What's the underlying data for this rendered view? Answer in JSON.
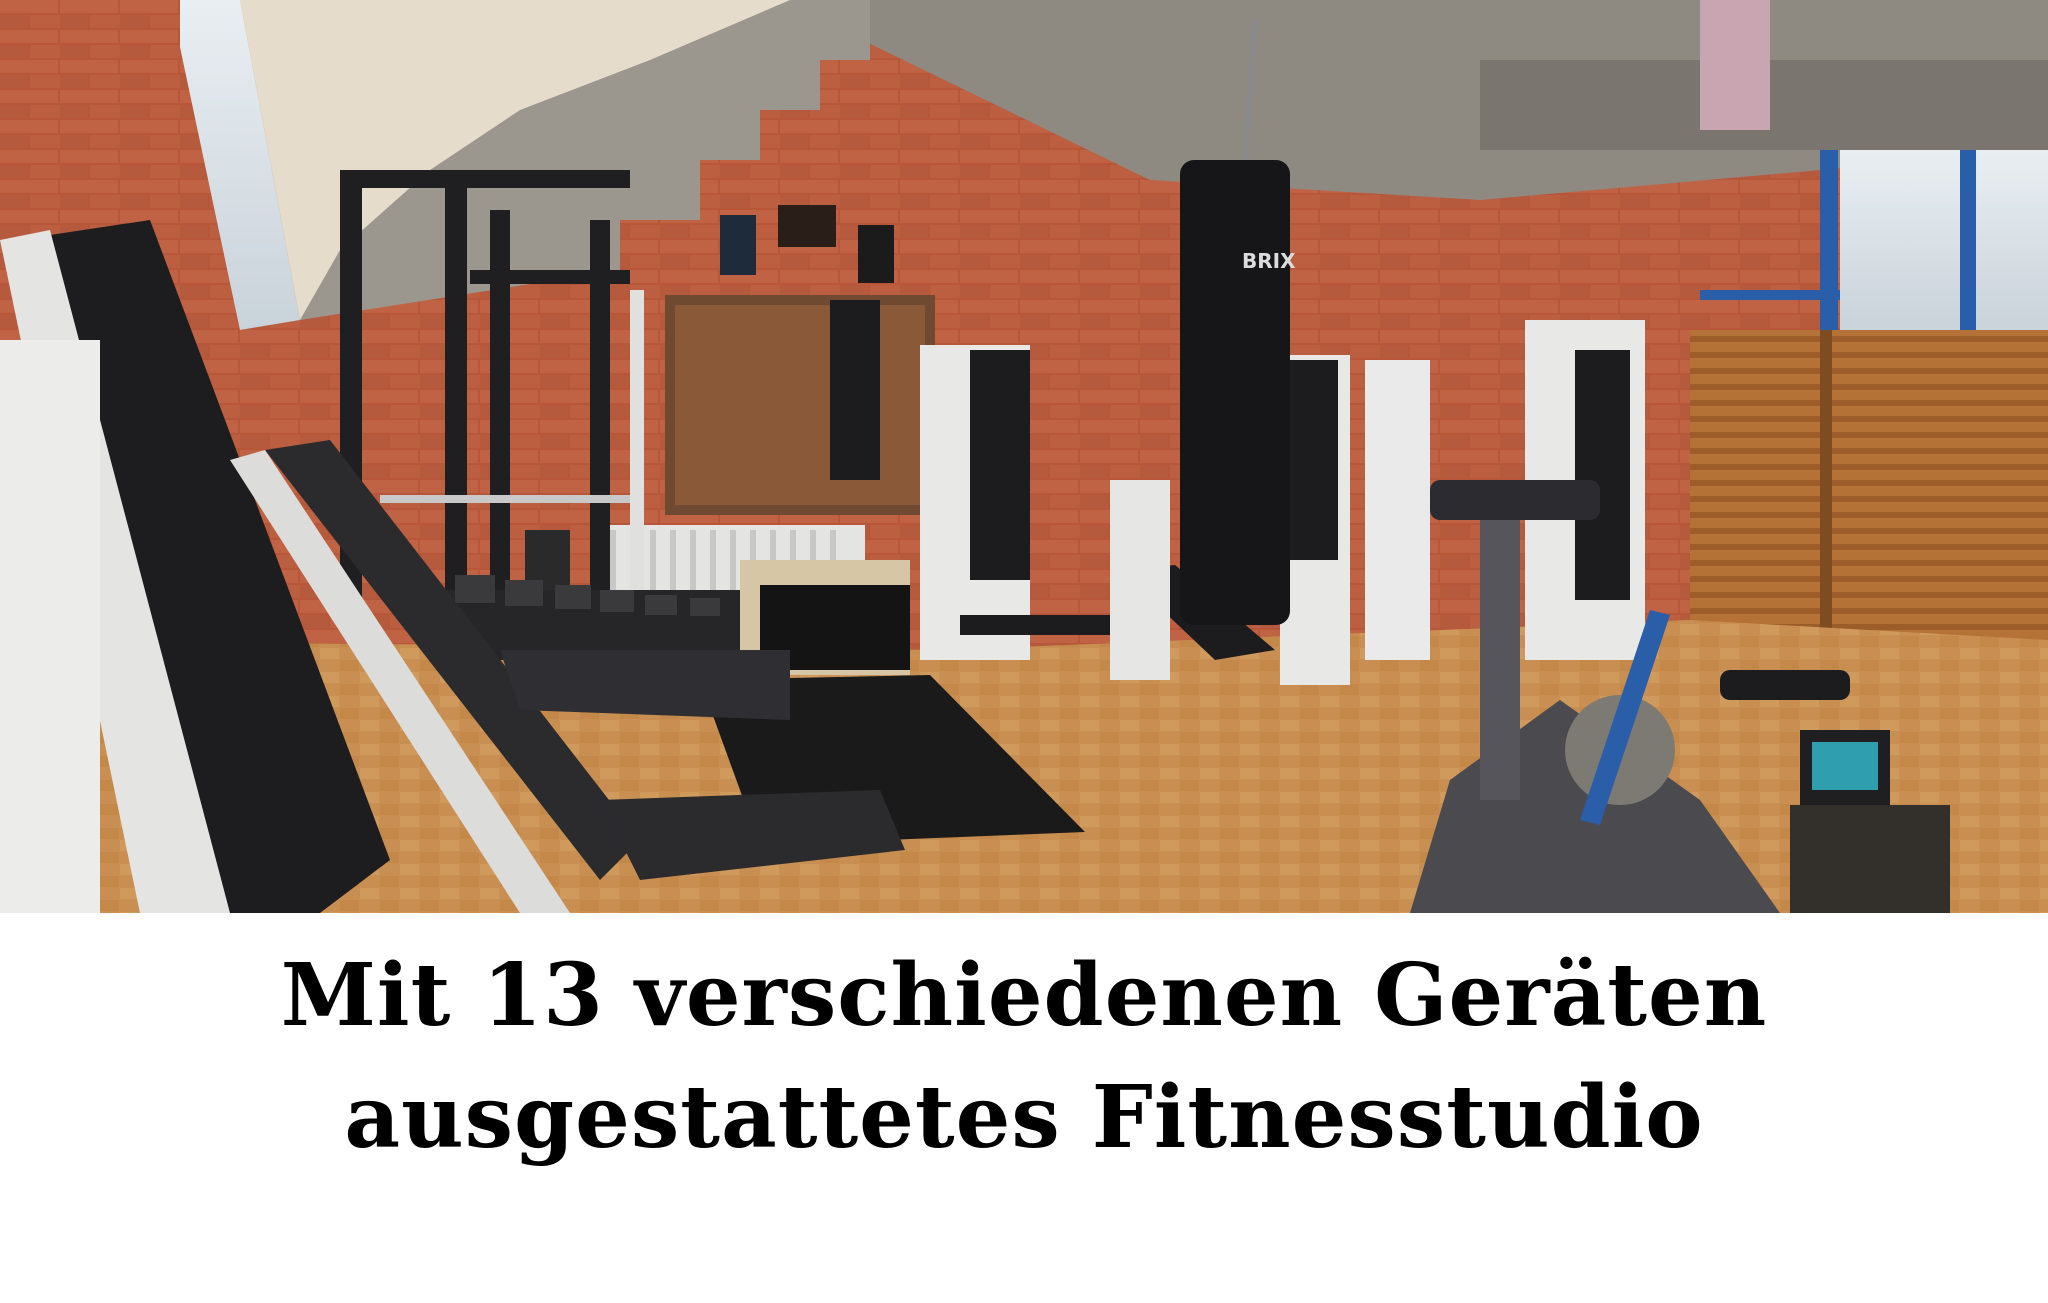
{
  "photo": {
    "subject": "gym-interior",
    "punching_bag_brand": "BRIX",
    "colors": {
      "brick": "#b8563a",
      "parquet": "#c98f52",
      "wood_panel": "#b57236",
      "ceiling_concrete": "#8e8a82",
      "equipment_black": "#1c1c1e",
      "equipment_white": "#e8e8e6",
      "blue_frame": "#2a5ea8"
    }
  },
  "caption": {
    "line1": "Mit 13 verschiedenen Geräten",
    "line2": "ausgestattetes Fitnesstudio",
    "color": "#000000"
  }
}
